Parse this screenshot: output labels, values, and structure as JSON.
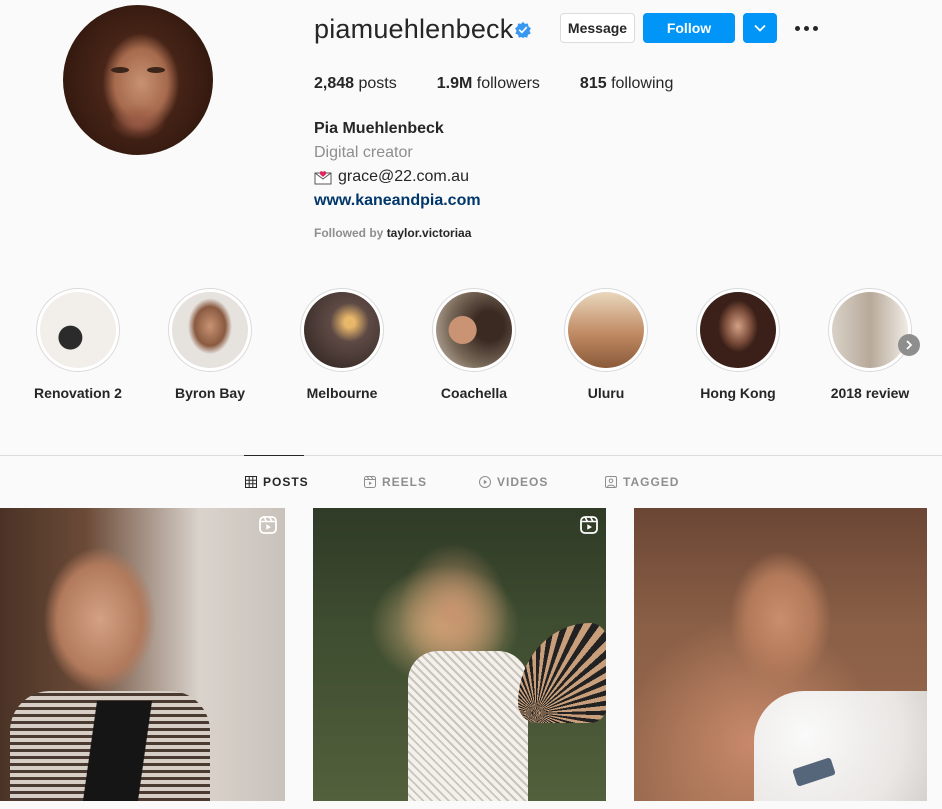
{
  "profile": {
    "username": "piamuehlenbeck",
    "verified": true,
    "buttons": {
      "message": "Message",
      "follow": "Follow"
    },
    "stats": {
      "posts_count": "2,848",
      "posts_label": "posts",
      "followers_count": "1.9M",
      "followers_label": "followers",
      "following_count": "815",
      "following_label": "following"
    },
    "full_name": "Pia Muehlenbeck",
    "category": "Digital creator",
    "email": "grace@22.com.au",
    "website": "www.kaneandpia.com",
    "followed_by_prefix": "Followed by",
    "followed_by_user": "taylor.victoriaa"
  },
  "highlights": [
    {
      "label": "Renovation 2",
      "color": "#e8e4df"
    },
    {
      "label": "Byron Bay",
      "color": "#b58a6f"
    },
    {
      "label": "Melbourne",
      "color": "#5e4a45"
    },
    {
      "label": "Coachella",
      "color": "#8a6a55"
    },
    {
      "label": "Uluru",
      "color": "#c08a63"
    },
    {
      "label": "Hong Kong",
      "color": "#7a4c3a"
    },
    {
      "label": "2018 review",
      "color": "#b7a99a"
    }
  ],
  "tabs": [
    {
      "label": "POSTS",
      "icon": "grid-icon",
      "active": true
    },
    {
      "label": "REELS",
      "icon": "reels-icon",
      "active": false
    },
    {
      "label": "VIDEOS",
      "icon": "play-icon",
      "active": false
    },
    {
      "label": "TAGGED",
      "icon": "tag-icon",
      "active": false
    }
  ],
  "posts": [
    {
      "type": "reel",
      "icon": "reels-icon"
    },
    {
      "type": "reel",
      "icon": "reels-icon"
    },
    {
      "type": "photo"
    }
  ],
  "colors": {
    "accent": "#0095f6",
    "link": "#00376b",
    "muted": "#8e8e8e"
  }
}
